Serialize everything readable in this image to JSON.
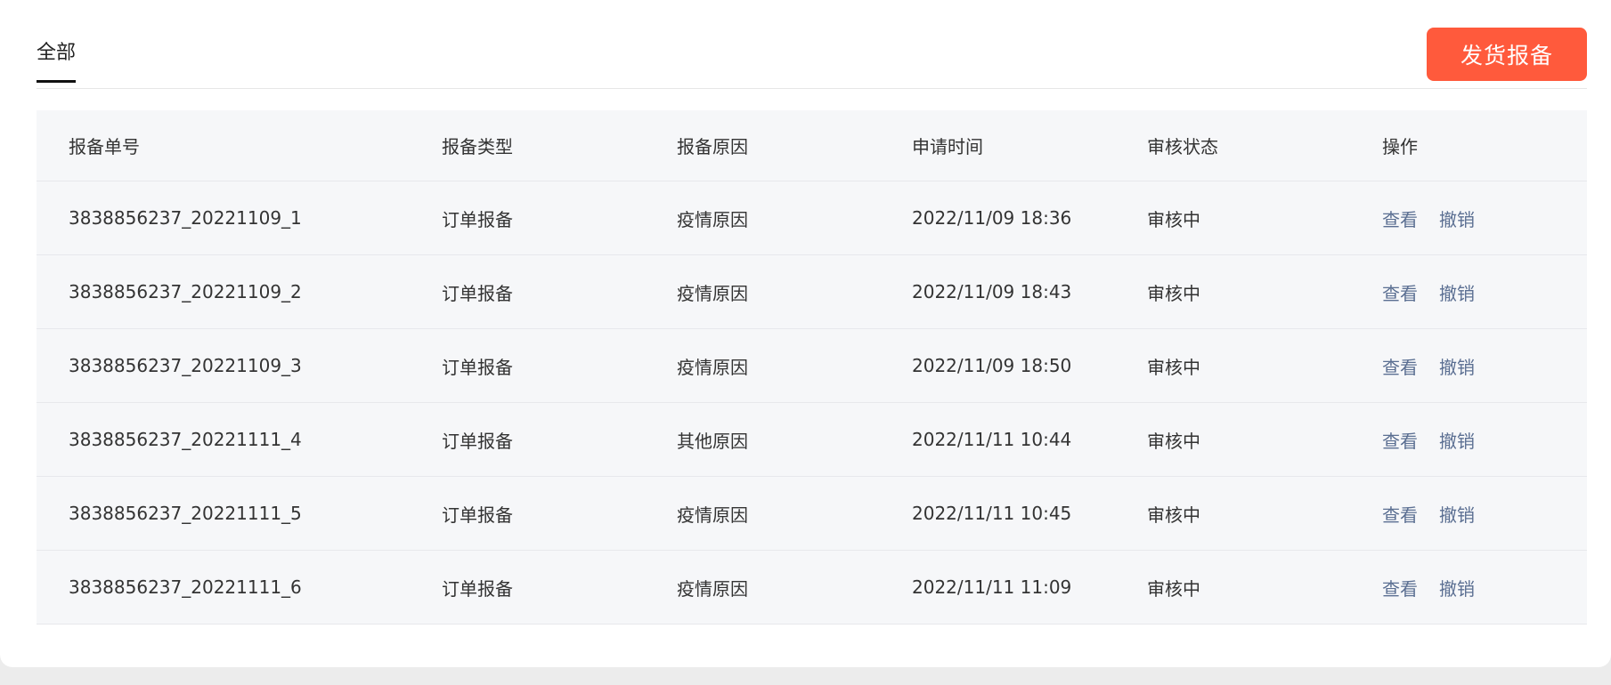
{
  "tabs": [
    {
      "label": "全部",
      "active": true
    }
  ],
  "toolbar": {
    "ship_report_label": "发货报备"
  },
  "table": {
    "headers": [
      "报备单号",
      "报备类型",
      "报备原因",
      "申请时间",
      "审核状态",
      "操作"
    ],
    "rows": [
      {
        "id": "3838856237_20221109_1",
        "type": "订单报备",
        "reason": "疫情原因",
        "time": "2022/11/09 18:36",
        "status": "审核中",
        "actions": [
          "查看",
          "撤销"
        ]
      },
      {
        "id": "3838856237_20221109_2",
        "type": "订单报备",
        "reason": "疫情原因",
        "time": "2022/11/09 18:43",
        "status": "审核中",
        "actions": [
          "查看",
          "撤销"
        ]
      },
      {
        "id": "3838856237_20221109_3",
        "type": "订单报备",
        "reason": "疫情原因",
        "time": "2022/11/09 18:50",
        "status": "审核中",
        "actions": [
          "查看",
          "撤销"
        ]
      },
      {
        "id": "3838856237_20221111_4",
        "type": "订单报备",
        "reason": "其他原因",
        "time": "2022/11/11 10:44",
        "status": "审核中",
        "actions": [
          "查看",
          "撤销"
        ]
      },
      {
        "id": "3838856237_20221111_5",
        "type": "订单报备",
        "reason": "疫情原因",
        "time": "2022/11/11 10:45",
        "status": "审核中",
        "actions": [
          "查看",
          "撤销"
        ]
      },
      {
        "id": "3838856237_20221111_6",
        "type": "订单报备",
        "reason": "疫情原因",
        "time": "2022/11/11 11:09",
        "status": "审核中",
        "actions": [
          "查看",
          "撤销"
        ]
      }
    ]
  },
  "colors": {
    "accent": "#ff5a3c",
    "link": "#5b6f92",
    "table_bg": "#f6f7f9"
  }
}
